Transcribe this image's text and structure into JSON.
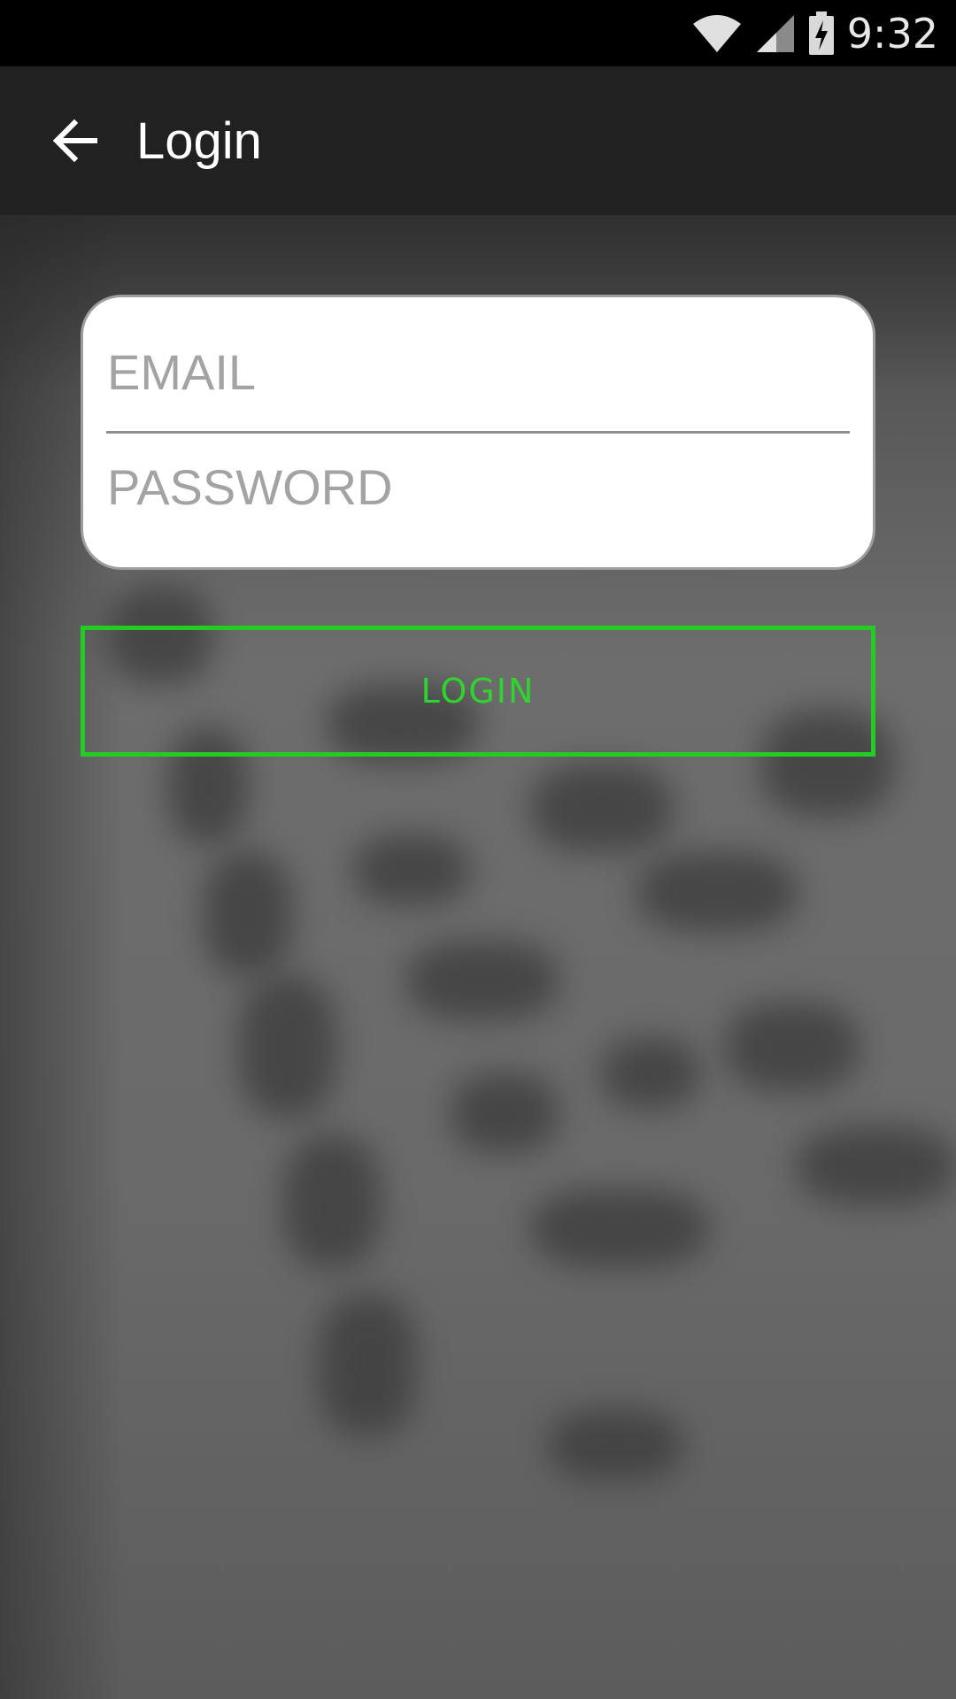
{
  "status_bar": {
    "time": "9:32",
    "icons": [
      "wifi-icon",
      "cell-signal-icon",
      "battery-charging-icon"
    ]
  },
  "app_bar": {
    "back_icon": "arrow-left-icon",
    "title": "Login"
  },
  "form": {
    "email_placeholder": "EMAIL",
    "email_value": "",
    "password_placeholder": "PASSWORD",
    "password_value": ""
  },
  "login_button": {
    "label": "LOGIN"
  },
  "colors": {
    "status_bar": "#000000",
    "app_bar": "#212121",
    "accent_green": "#22cc22",
    "card_background": "#ffffff",
    "placeholder_text": "#a3a3a3"
  }
}
